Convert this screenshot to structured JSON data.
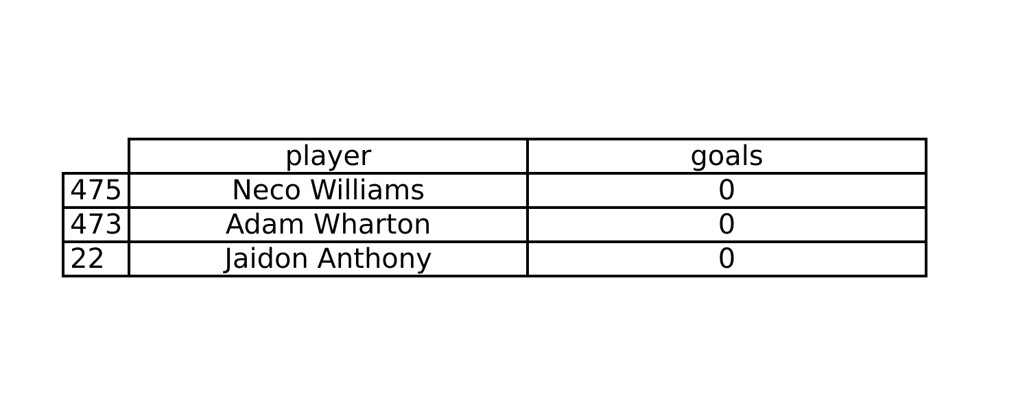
{
  "chart_data": {
    "type": "table",
    "columns": [
      "player",
      "goals"
    ],
    "index": [
      "475",
      "473",
      "22"
    ],
    "rows": [
      [
        "Neco Williams",
        "0"
      ],
      [
        "Adam Wharton",
        "0"
      ],
      [
        "Jaidon Anthony",
        "0"
      ]
    ]
  },
  "colors": {
    "border": "#000000",
    "text": "#000000",
    "background": "#ffffff"
  }
}
